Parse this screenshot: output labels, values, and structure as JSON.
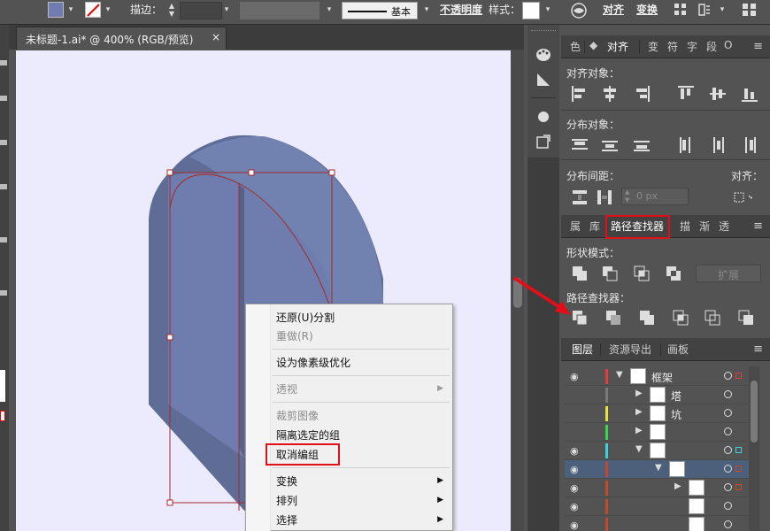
{
  "toolbar": {
    "stroke_label": "描边：",
    "brush_label": "基本",
    "opacity_label": "不透明度",
    "style_label": "样式：",
    "align_label": "对齐",
    "transform_label": "变换"
  },
  "document": {
    "tab_title": "未标题-1.ai* @ 400% (RGB/预览)",
    "close_glyph": "×"
  },
  "align_panel": {
    "tabs": [
      "色",
      "对齐",
      "变",
      "符",
      "字",
      "段",
      "O"
    ],
    "active_tab": "对齐",
    "align_objects_label": "对齐对象：",
    "distribute_objects_label": "分布对象：",
    "distribute_spacing_label": "分布间距：",
    "align_to_label": "对齐：",
    "spacing_value": "0 px"
  },
  "pathfinder_panel": {
    "tabs": [
      "属",
      "库",
      "路径查找器",
      "描",
      "渐",
      "透"
    ],
    "active_tab": "路径查找器",
    "shape_modes_label": "形状模式：",
    "expand_label": "扩展",
    "pathfinders_label": "路径查找器："
  },
  "layers_panel": {
    "tabs": [
      "图层",
      "资源导出",
      "画板"
    ],
    "active_tab": "图层",
    "rows": [
      {
        "name": "框架",
        "color": "#e23b3b",
        "square": "#e23b3b"
      },
      {
        "name": "塔",
        "color": "#7a7a7a",
        "square": ""
      },
      {
        "name": "坑",
        "color": "#e8e23b",
        "square": ""
      },
      {
        "name": "",
        "color": "#3bd64a",
        "square": ""
      },
      {
        "name": "",
        "color": "#3bd3e0",
        "square": "#3bd3e0"
      },
      {
        "name": "",
        "color": "#c24a2a",
        "square": "#c24a2a"
      },
      {
        "name": "",
        "color": "#c24a2a",
        "square": "#c24a2a"
      },
      {
        "name": "",
        "color": "#c24a2a",
        "square": ""
      },
      {
        "name": "",
        "color": "#c24a2a",
        "square": ""
      }
    ]
  },
  "context_menu": {
    "items": [
      {
        "label": "还原(U)分割",
        "disabled": false,
        "submenu": false
      },
      {
        "label": "重做(R)",
        "disabled": true,
        "submenu": false
      },
      {
        "label": "设为像素级优化",
        "disabled": false,
        "submenu": false
      },
      {
        "label": "透视",
        "disabled": true,
        "submenu": true
      },
      {
        "label": "裁剪图像",
        "disabled": true,
        "submenu": false
      },
      {
        "label": "隔离选定的组",
        "disabled": false,
        "submenu": false
      },
      {
        "label": "取消编组",
        "disabled": false,
        "submenu": false
      },
      {
        "label": "变换",
        "disabled": false,
        "submenu": true
      },
      {
        "label": "排列",
        "disabled": false,
        "submenu": true
      },
      {
        "label": "选择",
        "disabled": false,
        "submenu": true
      }
    ],
    "arrow_glyph": "▶"
  },
  "colors": {
    "fill_swatch": "#6f7eae",
    "shape_front": "#7080b0",
    "shape_side": "#5f6c96",
    "selection": "#a52a2a",
    "highlight_box": "#e10f1a",
    "artboard": "#ecebfd"
  },
  "icons": [
    "fill-swatch-icon",
    "stroke-none-icon",
    "stepper-icon",
    "globe-icon",
    "grid-icon",
    "eye-icon",
    "panel-menu-icon",
    "arrow-annotation-icon"
  ]
}
